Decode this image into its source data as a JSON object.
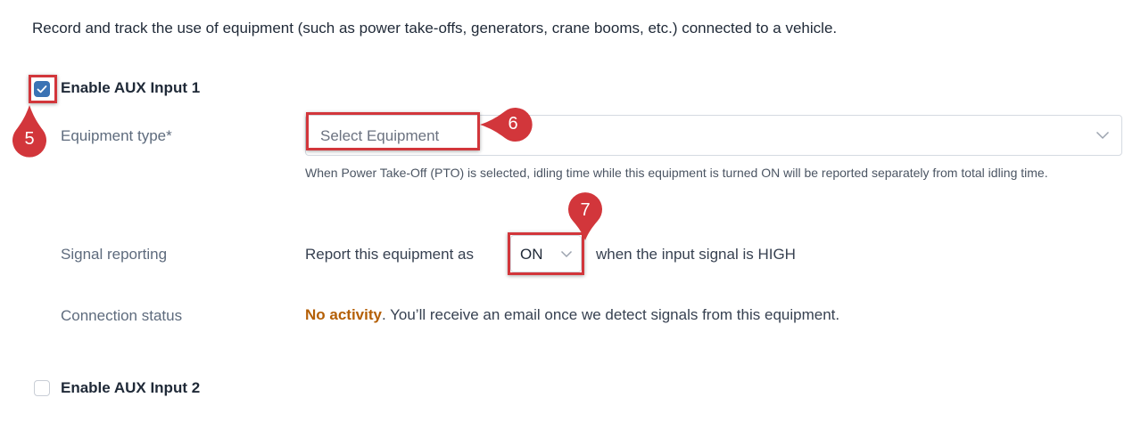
{
  "intro_text": "Record and track the use of equipment (such as power take-offs, generators, crane booms, etc.) connected to a vehicle.",
  "aux1": {
    "label": "Enable AUX Input 1",
    "checked": true,
    "equipment_type": {
      "label": "Equipment type*",
      "placeholder": "Select Equipment",
      "helper": "When Power Take-Off (PTO) is selected, idling time while this equipment is turned ON will be reported separately from total idling time."
    },
    "signal_reporting": {
      "label": "Signal reporting",
      "prefix": "Report this equipment as",
      "value": "ON",
      "suffix": "when the input signal is HIGH"
    },
    "connection_status": {
      "label": "Connection status",
      "status": "No activity",
      "message": ". You’ll receive an email once we detect signals from this equipment."
    }
  },
  "aux2": {
    "label": "Enable AUX Input 2",
    "checked": false
  },
  "annotations": {
    "marker_5": "5",
    "marker_6": "6",
    "marker_7": "7",
    "color": "#d2363b"
  },
  "colors": {
    "checkbox_checked": "#3b73b4",
    "status_warning": "#b45f06"
  }
}
